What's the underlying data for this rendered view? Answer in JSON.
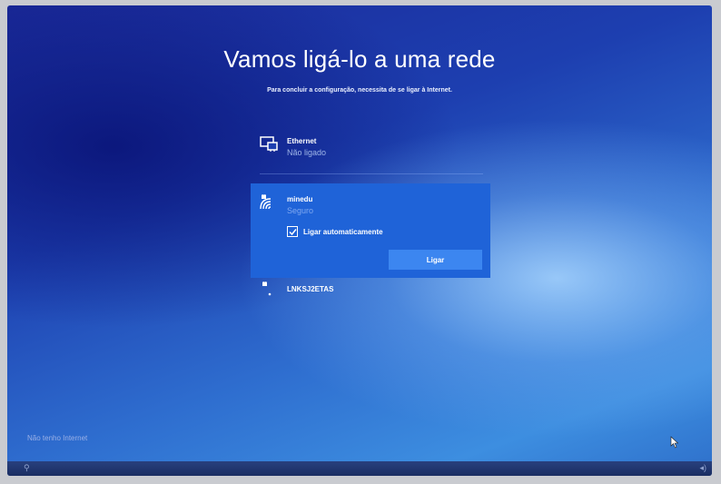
{
  "header": {
    "title": "Vamos ligá-lo a uma rede",
    "subtitle": "Para concluir a configuração, necessita de se ligar à Internet."
  },
  "networks": [
    {
      "name": "Ethernet",
      "status": "Não ligado",
      "icon": "ethernet-icon"
    },
    {
      "name": "minedu",
      "status": "Seguro",
      "icon": "wifi-secure-icon",
      "auto_connect_label": "Ligar automaticamente",
      "auto_connect_checked": true,
      "connect_label": "Ligar"
    },
    {
      "name": "LNKSJ2ETAS",
      "status": "",
      "icon": "wifi-icon"
    }
  ],
  "footer": {
    "no_internet_label": "Não tenho Internet"
  },
  "colors": {
    "accent": "#1f63d8",
    "button": "#3c86f0"
  }
}
